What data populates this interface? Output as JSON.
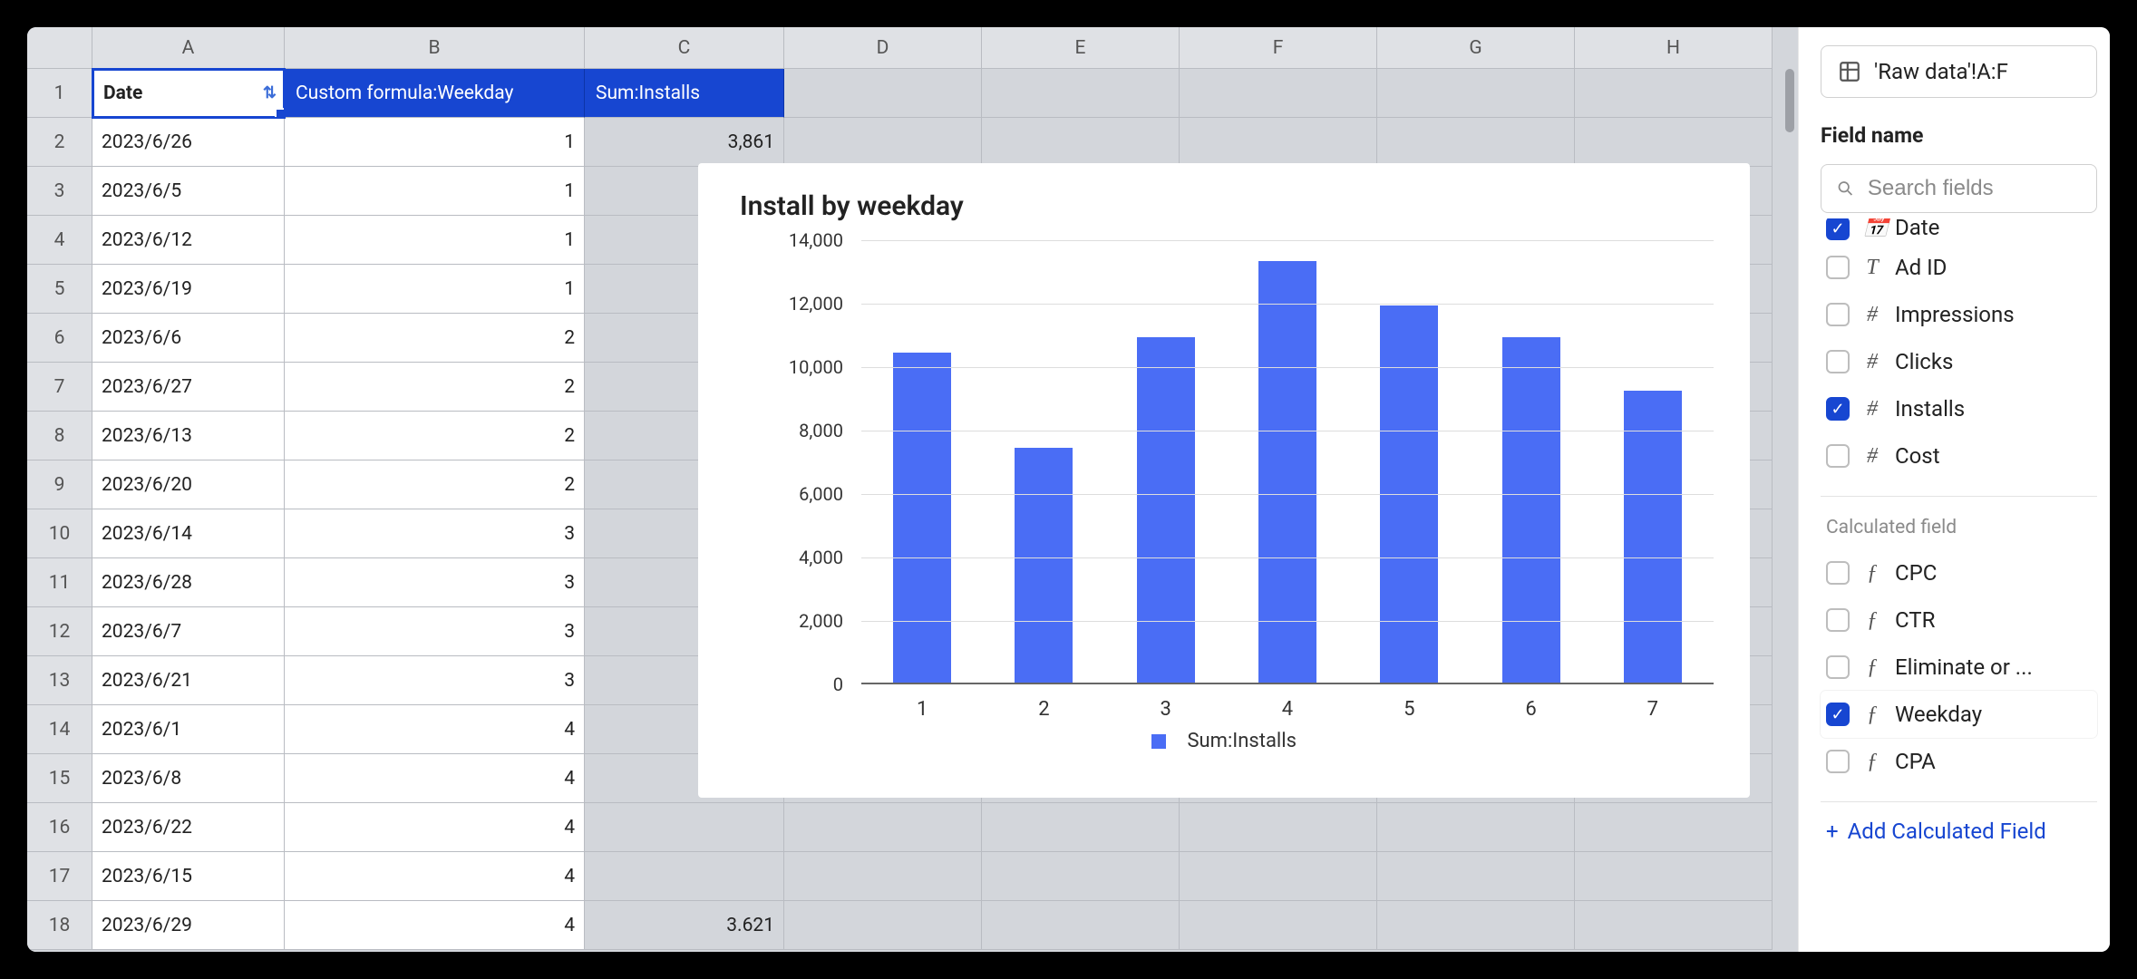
{
  "grid": {
    "columns": [
      "A",
      "B",
      "C",
      "D",
      "E",
      "F",
      "G",
      "H"
    ],
    "headers": {
      "date": "Date",
      "custom_formula": "Custom formula:Weekday",
      "sum_installs": "Sum:Installs"
    },
    "rows": [
      {
        "n": 2,
        "date": "2023/6/26",
        "wd": "1",
        "sum": "3,861"
      },
      {
        "n": 3,
        "date": "2023/6/5",
        "wd": "1",
        "sum": ""
      },
      {
        "n": 4,
        "date": "2023/6/12",
        "wd": "1",
        "sum": ""
      },
      {
        "n": 5,
        "date": "2023/6/19",
        "wd": "1",
        "sum": ""
      },
      {
        "n": 6,
        "date": "2023/6/6",
        "wd": "2",
        "sum": ""
      },
      {
        "n": 7,
        "date": "2023/6/27",
        "wd": "2",
        "sum": ""
      },
      {
        "n": 8,
        "date": "2023/6/13",
        "wd": "2",
        "sum": ""
      },
      {
        "n": 9,
        "date": "2023/6/20",
        "wd": "2",
        "sum": ""
      },
      {
        "n": 10,
        "date": "2023/6/14",
        "wd": "3",
        "sum": ""
      },
      {
        "n": 11,
        "date": "2023/6/28",
        "wd": "3",
        "sum": ""
      },
      {
        "n": 12,
        "date": "2023/6/7",
        "wd": "3",
        "sum": ""
      },
      {
        "n": 13,
        "date": "2023/6/21",
        "wd": "3",
        "sum": ""
      },
      {
        "n": 14,
        "date": "2023/6/1",
        "wd": "4",
        "sum": ""
      },
      {
        "n": 15,
        "date": "2023/6/8",
        "wd": "4",
        "sum": ""
      },
      {
        "n": 16,
        "date": "2023/6/22",
        "wd": "4",
        "sum": ""
      },
      {
        "n": 17,
        "date": "2023/6/15",
        "wd": "4",
        "sum": ""
      },
      {
        "n": 18,
        "date": "2023/6/29",
        "wd": "4",
        "sum": "3.621"
      }
    ]
  },
  "chart_data": {
    "type": "bar",
    "title": "Install by weekday",
    "categories": [
      "1",
      "2",
      "3",
      "4",
      "5",
      "6",
      "7"
    ],
    "values": [
      10400,
      7400,
      10900,
      13300,
      11900,
      10900,
      9200
    ],
    "xlabel": "",
    "ylabel": "",
    "ylim": [
      0,
      14000
    ],
    "yticks": [
      0,
      2000,
      4000,
      6000,
      8000,
      10000,
      12000,
      14000
    ],
    "ytick_labels": [
      "0",
      "2,000",
      "4,000",
      "6,000",
      "8,000",
      "10,000",
      "12,000",
      "14,000"
    ],
    "legend": "Sum:Installs"
  },
  "sidebar": {
    "range": "'Raw data'!A:F",
    "heading": "Field name",
    "search_placeholder": "Search fields",
    "fields_cut_top": "Date",
    "fields": [
      {
        "checked": false,
        "icon": "T",
        "label": "Ad ID"
      },
      {
        "checked": false,
        "icon": "#",
        "label": "Impressions"
      },
      {
        "checked": false,
        "icon": "#",
        "label": "Clicks"
      },
      {
        "checked": true,
        "icon": "#",
        "label": "Installs"
      },
      {
        "checked": false,
        "icon": "#",
        "label": "Cost"
      }
    ],
    "calc_heading": "Calculated field",
    "calc_fields": [
      {
        "checked": false,
        "label": "CPC",
        "hl": false
      },
      {
        "checked": false,
        "label": "CTR",
        "hl": false
      },
      {
        "checked": false,
        "label": "Eliminate or ...",
        "hl": false
      },
      {
        "checked": true,
        "label": "Weekday",
        "hl": true
      },
      {
        "checked": false,
        "label": "CPA",
        "hl": false
      }
    ],
    "add_calc": "Add Calculated Field"
  }
}
